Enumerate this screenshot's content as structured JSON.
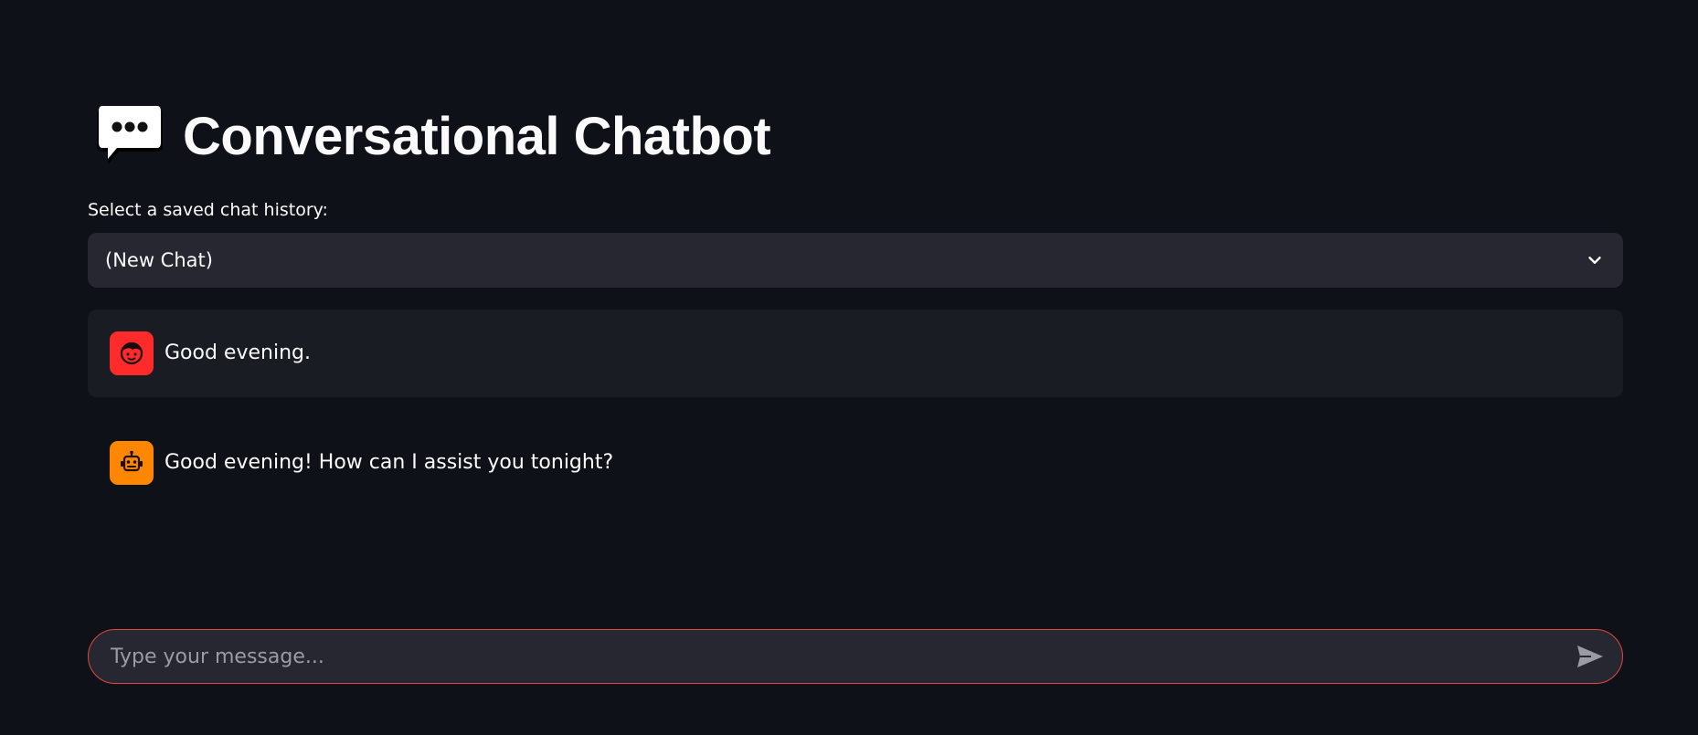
{
  "header": {
    "title": "Conversational Chatbot",
    "title_icon": "speech-balloon-icon"
  },
  "history_select": {
    "label": "Select a saved chat history:",
    "selected_value": "(New Chat)",
    "icon": "chevron-down-icon"
  },
  "messages": [
    {
      "role": "user",
      "avatar_icon": "user-face-icon",
      "avatar_color": "#ff2b2b",
      "text": "Good evening."
    },
    {
      "role": "assistant",
      "avatar_icon": "robot-face-icon",
      "avatar_color": "#ff8700",
      "text": "Good evening! How can I assist you tonight?"
    }
  ],
  "chat_input": {
    "placeholder": "Type your message...",
    "value": "",
    "send_icon": "send-icon",
    "focus_border_color": "#e0463d"
  },
  "theme": {
    "background": "#0e1117",
    "surface": "#262730",
    "text": "#fafafa"
  }
}
